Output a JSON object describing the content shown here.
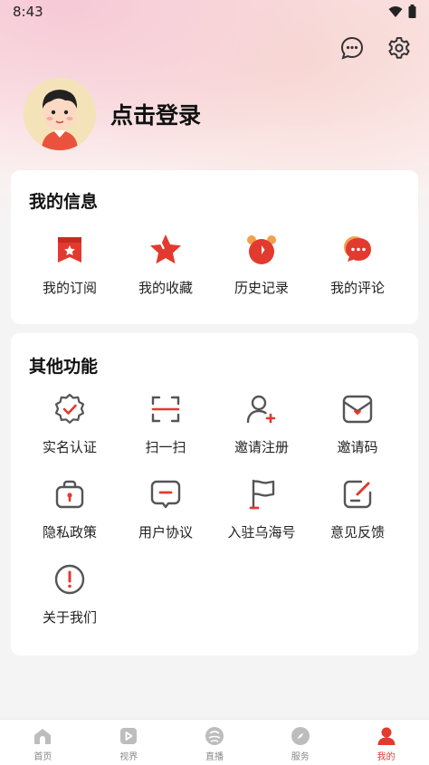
{
  "status": {
    "time": "8:43"
  },
  "profile": {
    "login_text": "点击登录"
  },
  "my_info": {
    "title": "我的信息",
    "items": [
      {
        "label": "我的订阅",
        "icon": "subscription-icon"
      },
      {
        "label": "我的收藏",
        "icon": "star-icon"
      },
      {
        "label": "历史记录",
        "icon": "alarm-clock-icon"
      },
      {
        "label": "我的评论",
        "icon": "comment-icon"
      }
    ]
  },
  "other": {
    "title": "其他功能",
    "items": [
      {
        "label": "实名认证",
        "icon": "verified-badge-icon"
      },
      {
        "label": "扫一扫",
        "icon": "scan-icon"
      },
      {
        "label": "邀请注册",
        "icon": "add-user-icon"
      },
      {
        "label": "邀请码",
        "icon": "mail-heart-icon"
      },
      {
        "label": "隐私政策",
        "icon": "lock-bag-icon"
      },
      {
        "label": "用户协议",
        "icon": "message-icon"
      },
      {
        "label": "入驻乌海号",
        "icon": "flag-icon"
      },
      {
        "label": "意见反馈",
        "icon": "edit-icon"
      },
      {
        "label": "关于我们",
        "icon": "info-icon"
      }
    ]
  },
  "tabs": [
    {
      "label": "首页",
      "icon": "home-icon"
    },
    {
      "label": "视界",
      "icon": "play-icon"
    },
    {
      "label": "直播",
      "icon": "live-icon"
    },
    {
      "label": "服务",
      "icon": "compass-icon"
    },
    {
      "label": "我的",
      "icon": "user-icon",
      "active": true
    }
  ],
  "colors": {
    "accent": "#e23a2e",
    "icon_gray": "#555555"
  }
}
